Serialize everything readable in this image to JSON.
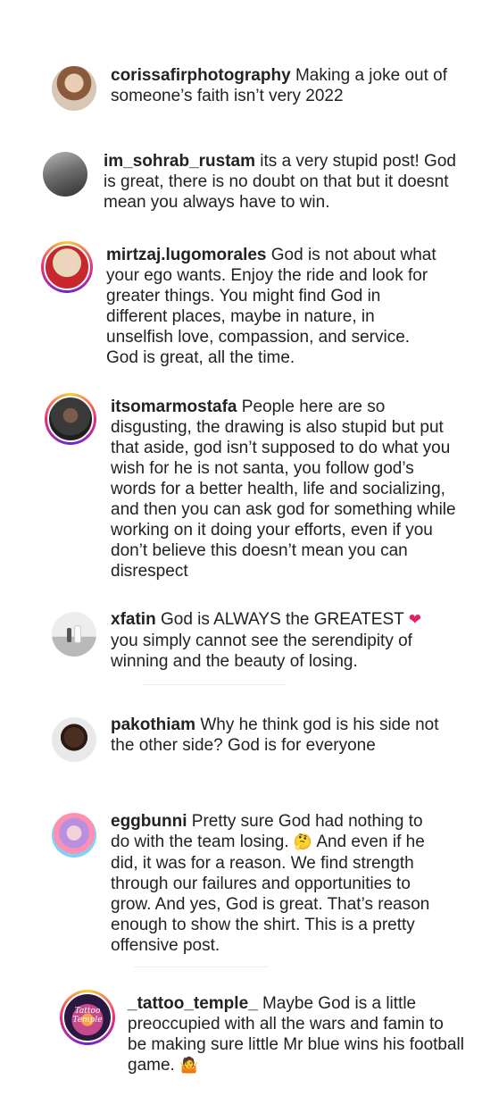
{
  "comments": [
    {
      "username": "corissafirphotography",
      "text": "Making a joke out of someone’s faith isn’t very 2022"
    },
    {
      "username": "im_sohrab_rustam",
      "text": "its a very stupid post! God is great, there is no doubt on that but it doesnt mean you always have to win."
    },
    {
      "username": "mirtzaj.lugomorales",
      "text": "God is not about what your ego wants. Enjoy the ride and look for greater things. You might find God in different places, maybe in nature, in unselfish love, compassion, and service. God is great, all the time."
    },
    {
      "username": "itsomarmostafa",
      "text": "People here are so disgusting, the drawing is also stupid but put that aside, god isn’t supposed to do what you wish for he is not santa, you follow god’s words for a better health, life and socializing, and then you can ask god for something while working on it doing your efforts, even if you don’t believe this doesn’t mean you can disrespect"
    },
    {
      "username": "xfatin",
      "text": "God is ALWAYS the GREATEST",
      "emoji": "❤",
      "text2": "you simply cannot see the serendipity of winning and the beauty of losing."
    },
    {
      "username": "pakothiam",
      "text": "Why he think god is his side not the other side?  God is for everyone"
    },
    {
      "username": "eggbunni",
      "text": "Pretty sure God had nothing to do with the team losing.",
      "emoji": "🤔",
      "text2": "And even if he did, it was for a reason. We find strength through our failures and opportunities to grow. And yes, God is great. That’s reason enough to show the shirt. This is a pretty offensive post."
    },
    {
      "username": "_tattoo_temple_",
      "text": "Maybe God is a little preoccupied with all the wars and famin to be making sure little Mr blue wins his football game.",
      "emoji": "🤷"
    }
  ],
  "avatars": {
    "tattoo_logo_text": "Tattoo Temple"
  },
  "colors": {
    "story_ring_start": "#f9ce34",
    "story_ring_mid": "#ee2a7b",
    "story_ring_end": "#6228d7",
    "text": "#222222",
    "heart": "#e0245e"
  }
}
